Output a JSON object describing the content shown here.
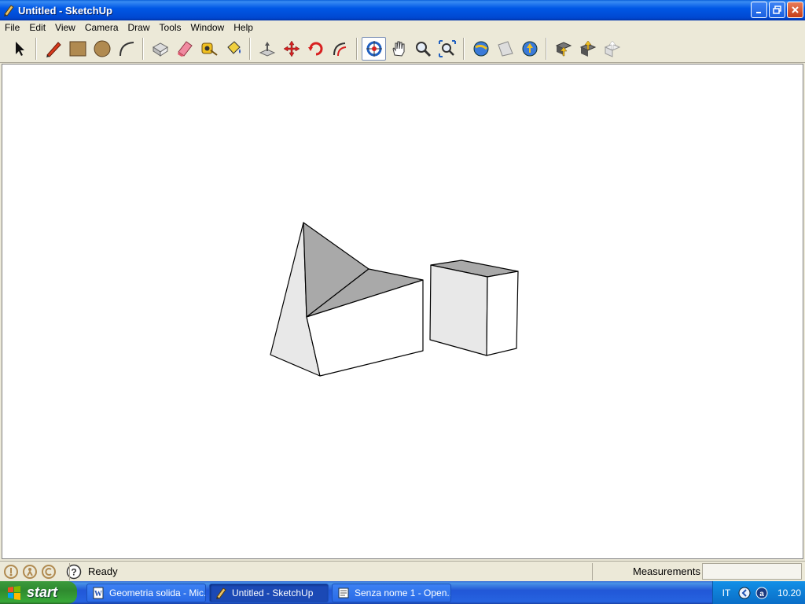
{
  "window": {
    "title": "Untitled - SketchUp"
  },
  "menu": [
    "File",
    "Edit",
    "View",
    "Camera",
    "Draw",
    "Tools",
    "Window",
    "Help"
  ],
  "toolbar": {
    "groups": [
      [
        "select-tool-icon"
      ],
      [
        "pencil-line-icon",
        "rectangle-icon",
        "circle-icon",
        "arc-icon"
      ],
      [
        "make-component-icon",
        "eraser-icon",
        "tape-measure-icon",
        "paint-bucket-icon"
      ],
      [
        "push-pull-icon",
        "move-icon",
        "rotate-icon",
        "offset-icon"
      ],
      [
        "orbit-icon",
        "pan-icon",
        "zoom-icon",
        "zoom-extents-icon"
      ],
      [
        "get-current-view-icon",
        "toggle-terrain-icon",
        "place-model-icon"
      ],
      [
        "get-models-icon",
        "share-model-icon",
        "share-component-icon"
      ]
    ],
    "active_tool": "orbit-icon"
  },
  "status": {
    "text": "Ready",
    "measurements_label": "Measurements",
    "measurements_value": ""
  },
  "taskbar": {
    "start_label": "start",
    "tasks": [
      {
        "label": "Geometria solida - Mic...",
        "icon": "word-document-icon",
        "active": false
      },
      {
        "label": "Untitled - SketchUp",
        "icon": "sketchup-icon",
        "active": true
      },
      {
        "label": "Senza nome 1 - Open...",
        "icon": "openoffice-icon",
        "active": false
      }
    ],
    "tray": {
      "language": "IT",
      "clock": "10.20"
    }
  },
  "colors": {
    "titlebar": "#0058e6",
    "taskbar": "#2457d4",
    "start": "#38a838",
    "viewport_bg": "#ffffff",
    "face_light": "#e8e8e8",
    "face_shadow": "#a9a9a9"
  }
}
